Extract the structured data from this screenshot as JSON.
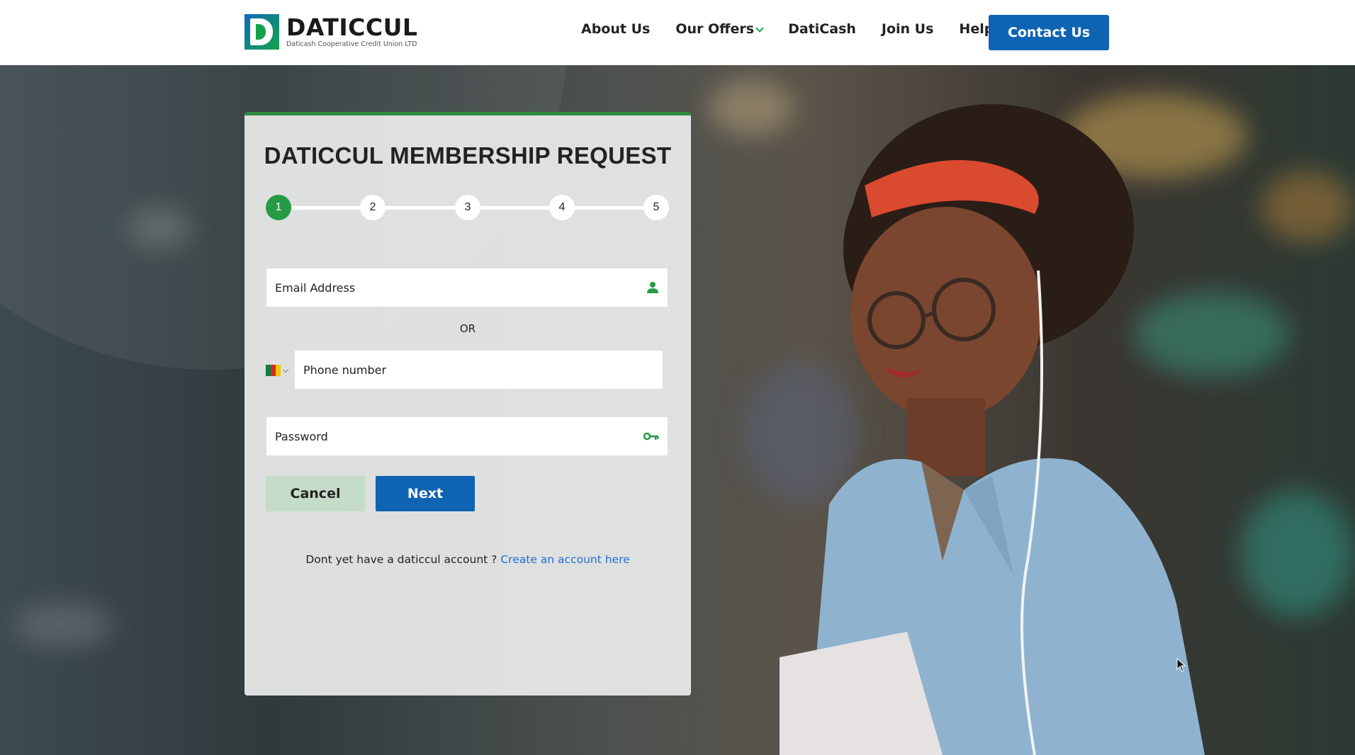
{
  "header": {
    "logo": {
      "name": "DATICCUL",
      "subtitle": "Daticash Cooperative Credit Union LTD"
    },
    "nav": [
      {
        "label": "About Us",
        "has_dropdown": false
      },
      {
        "label": "Our Offers",
        "has_dropdown": true
      },
      {
        "label": "DatiCash",
        "has_dropdown": false
      },
      {
        "label": "Join Us",
        "has_dropdown": false
      },
      {
        "label": "Help",
        "has_dropdown": false
      }
    ],
    "contact_label": "Contact Us"
  },
  "form": {
    "title": "DATICCUL MEMBERSHIP REQUEST",
    "steps": [
      "1",
      "2",
      "3",
      "4",
      "5"
    ],
    "active_step": 1,
    "email_placeholder": "Email Address",
    "or_label": "OR",
    "phone_placeholder": "Phone number",
    "country_flag": "cameroon-flag",
    "password_placeholder": "Password",
    "cancel_label": "Cancel",
    "next_label": "Next",
    "signup_text": "Dont yet have a daticcul account ?",
    "signup_link": "Create an account here"
  },
  "colors": {
    "brand_blue": "#0f63b3",
    "brand_green": "#279a46",
    "link_blue": "#1f6fd0"
  },
  "icons": {
    "email": "person-icon",
    "password": "key-icon",
    "dropdown": "chevron-down-icon"
  }
}
